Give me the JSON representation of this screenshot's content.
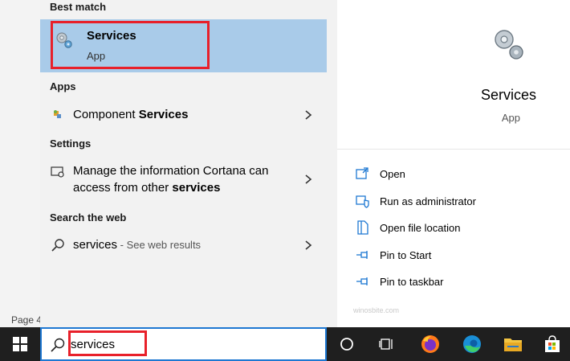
{
  "background_document": {
    "status_text": "Page 4"
  },
  "search_panel": {
    "sections": {
      "best_match": "Best match",
      "apps": "Apps",
      "settings": "Settings",
      "web": "Search the web"
    },
    "best_match": {
      "name": "Services",
      "type": "App",
      "icon": "gears-icon"
    },
    "apps": [
      {
        "prefix": "Component ",
        "match": "Services",
        "icon": "component-services-icon"
      }
    ],
    "settings": [
      {
        "line1": "Manage the information Cortana can",
        "line2_prefix": "access from other ",
        "line2_match": "services",
        "icon": "cortana-settings-icon"
      }
    ],
    "web": [
      {
        "query": "services",
        "hint": " - See web results",
        "icon": "search-icon"
      }
    ],
    "preview": {
      "title": "Services",
      "subtitle": "App",
      "actions": [
        {
          "label": "Open",
          "icon": "open-icon"
        },
        {
          "label": "Run as administrator",
          "icon": "shield-icon"
        },
        {
          "label": "Open file location",
          "icon": "file-location-icon"
        },
        {
          "label": "Pin to Start",
          "icon": "pin-icon"
        },
        {
          "label": "Pin to taskbar",
          "icon": "pin-icon"
        }
      ],
      "watermark": "winosbite.com"
    }
  },
  "taskbar": {
    "search": {
      "value": "services"
    },
    "items": [
      "cortana-icon",
      "task-view-icon",
      "firefox-icon",
      "edge-icon",
      "file-explorer-icon",
      "store-icon"
    ]
  },
  "colors": {
    "accent": "#1e78d2",
    "selection": "#a9cbe9",
    "annotation": "#e8202a",
    "taskbar": "#1f1f1f"
  }
}
